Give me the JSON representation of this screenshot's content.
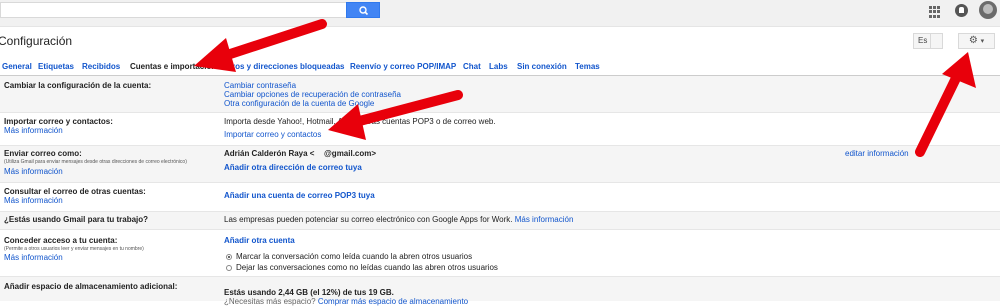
{
  "search": {
    "placeholder": "",
    "value": ""
  },
  "header": {
    "title": "Configuración",
    "language": "Es",
    "gear_caret": "▾"
  },
  "tabs": [
    "General",
    "Etiquetas",
    "Recibidos",
    "Cuentas e importación",
    "Filtros y direcciones bloqueadas",
    "Reenvío y correo POP/IMAP",
    "Chat",
    "Labs",
    "Sin conexión",
    "Temas"
  ],
  "rows": {
    "change_account": {
      "label": "Cambiar la configuración de la cuenta:",
      "links": [
        "Cambiar contraseña",
        "Cambiar opciones de recuperación de contraseña",
        "Otra configuración de la cuenta de Google"
      ]
    },
    "import": {
      "label": "Importar correo y contactos:",
      "more": "Más información",
      "desc": "Importa desde Yahoo!, Hotmail, AOL u otras cuentas POP3 o de correo web.",
      "action": "Importar correo y contactos"
    },
    "send_as": {
      "label": "Enviar correo como:",
      "sub": "(Utiliza Gmail para enviar mensajes desde otras direcciones de correo electrónico)",
      "more": "Más información",
      "name": "Adrián Calderón Raya <",
      "email_end": "@gmail.com>",
      "edit": "editar información",
      "action": "Añadir otra dirección de correo tuya"
    },
    "check_mail": {
      "label": "Consultar el correo de otras cuentas:",
      "more": "Más información",
      "action": "Añadir una cuenta de correo POP3 tuya"
    },
    "work": {
      "label": "¿Estás usando Gmail para tu trabajo?",
      "desc": "Las empresas pueden potenciar su correo electrónico con Google Apps for Work.",
      "more": "Más información"
    },
    "delegate": {
      "label": "Conceder acceso a tu cuenta:",
      "sub": "(Permite a otros usuarios leer y enviar mensajes en tu nombre)",
      "more": "Más información",
      "action": "Añadir otra cuenta",
      "option1": "Marcar la conversación como leída cuando la abren otros usuarios",
      "option2": "Dejar las conversaciones como no leídas cuando las abren otros usuarios"
    },
    "storage": {
      "label": "Añadir espacio de almacenamiento adicional:",
      "usage": "Estás usando 2,44 GB (el 12%) de tus 19 GB.",
      "need_more": "¿Necesitas más espacio?",
      "buy": "Comprar más espacio de almacenamiento"
    }
  },
  "colors": {
    "link": "#1155cc",
    "arrow": "#e8000b",
    "search_button": "#4285f4"
  }
}
